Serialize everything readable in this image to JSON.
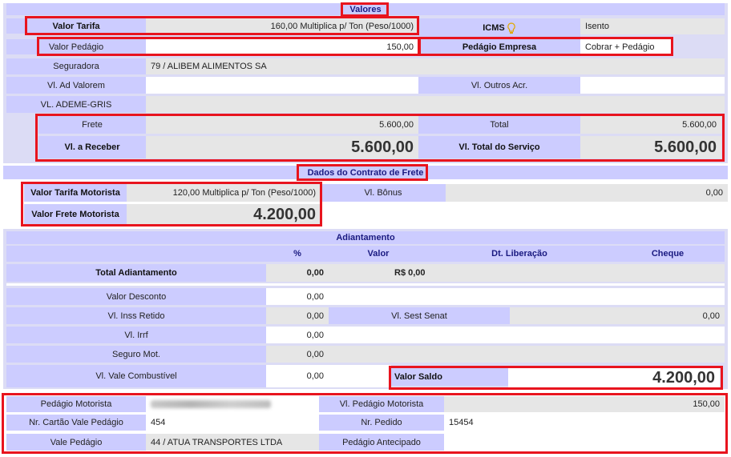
{
  "valores": {
    "title": "Valores",
    "valor_tarifa_label": "Valor Tarifa",
    "valor_tarifa": "160,00 Multiplica p/ Ton (Peso/1000)",
    "icms_label": "ICMS",
    "icms_value": "Isento",
    "valor_pedagio_label": "Valor Pedágio",
    "valor_pedagio": "150,00",
    "pedagio_empresa_label": "Pedágio Empresa",
    "pedagio_empresa": "Cobrar + Pedágio",
    "seguradora_label": "Seguradora",
    "seguradora": "79 / ALIBEM ALIMENTOS SA",
    "ad_valorem_label": "Vl. Ad Valorem",
    "outros_acr_label": "Vl. Outros Acr.",
    "ademe_label": "VL. ADEME-GRIS",
    "frete_label": "Frete",
    "frete": "5.600,00",
    "total_label": "Total",
    "total": "5.600,00",
    "receber_label": "Vl. a Receber",
    "receber": "5.600,00",
    "total_servico_label": "Vl. Total do Serviço",
    "total_servico": "5.600,00"
  },
  "contrato": {
    "title": "Dados do Contrato de Frete",
    "tarifa_motorista_label": "Valor Tarifa Motorista",
    "tarifa_motorista": "120,00 Multiplica p/ Ton (Peso/1000)",
    "bonus_label": "Vl. Bônus",
    "bonus": "0,00",
    "frete_motorista_label": "Valor Frete Motorista",
    "frete_motorista": "4.200,00"
  },
  "adiantamento": {
    "title": "Adiantamento",
    "col_pct": "%",
    "col_valor": "Valor",
    "col_dt": "Dt. Liberação",
    "col_cheque": "Cheque",
    "total_label": "Total Adiantamento",
    "total_pct": "0,00",
    "total_valor": "R$ 0,00"
  },
  "descontos": {
    "valor_desconto_label": "Valor Desconto",
    "valor_desconto": "0,00",
    "inss_label": "Vl. Inss Retido",
    "inss": "0,00",
    "sest_label": "Vl. Sest Senat",
    "sest": "0,00",
    "irrf_label": "Vl. Irrf",
    "irrf": "0,00",
    "seguro_label": "Seguro Mot.",
    "seguro": "0,00",
    "combustivel_label": "Vl. Vale Combustível",
    "combustivel": "0,00",
    "saldo_label": "Valor Saldo",
    "saldo": "4.200,00"
  },
  "pedagio": {
    "pedagio_motorista_label": "Pedágio Motorista",
    "vl_pedagio_motorista_label": "Vl. Pedágio Motorista",
    "vl_pedagio_motorista": "150,00",
    "cartao_label": "Nr. Cartão Vale Pedágio",
    "cartao": "454",
    "pedido_label": "Nr. Pedido",
    "pedido": "15454",
    "vale_label": "Vale Pedágio",
    "vale": "44 / ATUA TRANSPORTES LTDA",
    "antecipado_label": "Pedágio Antecipado"
  },
  "colors": {
    "label_bg": "#ccccff",
    "value_bg": "#e6e6e6",
    "highlight": "#e8141e"
  }
}
